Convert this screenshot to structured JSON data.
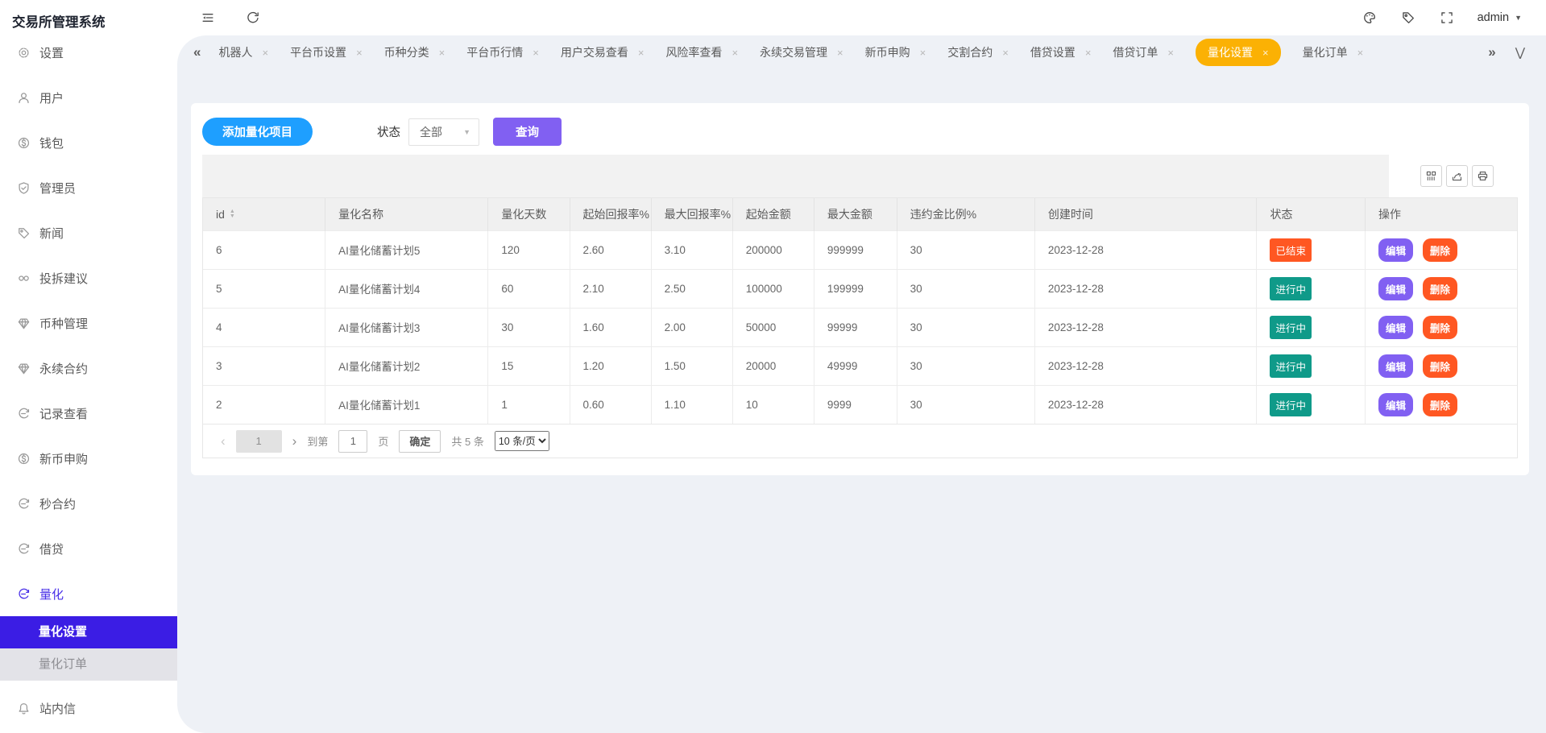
{
  "app": {
    "title": "交易所管理系统"
  },
  "sidebar": {
    "items": [
      {
        "label": "设置",
        "icon": "gear"
      },
      {
        "label": "用户",
        "icon": "user"
      },
      {
        "label": "钱包",
        "icon": "dollar"
      },
      {
        "label": "管理员",
        "icon": "shield"
      },
      {
        "label": "新闻",
        "icon": "tag"
      },
      {
        "label": "投拆建议",
        "icon": "infinity"
      },
      {
        "label": "币种管理",
        "icon": "gem"
      },
      {
        "label": "永续合约",
        "icon": "gem"
      },
      {
        "label": "记录查看",
        "icon": "circlearrow"
      },
      {
        "label": "新币申购",
        "icon": "dollar"
      },
      {
        "label": "秒合约",
        "icon": "circlearrow"
      },
      {
        "label": "借贷",
        "icon": "circlearrow"
      },
      {
        "label": "量化",
        "icon": "circlearrow",
        "active": true
      }
    ],
    "submenu": [
      {
        "label": "量化设置",
        "selected": true
      },
      {
        "label": "量化订单",
        "selected": false
      }
    ],
    "bottom_item": {
      "label": "站内信",
      "icon": "bell"
    }
  },
  "topbar": {
    "username": "admin"
  },
  "tabs": {
    "items": [
      {
        "label": "机器人"
      },
      {
        "label": "平台币设置"
      },
      {
        "label": "币种分类"
      },
      {
        "label": "平台币行情"
      },
      {
        "label": "用户交易查看"
      },
      {
        "label": "风险率查看"
      },
      {
        "label": "永续交易管理"
      },
      {
        "label": "新币申购"
      },
      {
        "label": "交割合约"
      },
      {
        "label": "借贷设置"
      },
      {
        "label": "借贷订单"
      },
      {
        "label": "量化设置",
        "active": true
      },
      {
        "label": "量化订单"
      }
    ]
  },
  "toolbar": {
    "add_button": "添加量化项目",
    "status_label": "状态",
    "status_value": "全部",
    "query_button": "查询"
  },
  "table": {
    "columns": [
      "id",
      "量化名称",
      "量化天数",
      "起始回报率%",
      "最大回报率%",
      "起始金额",
      "最大金额",
      "违约金比例%",
      "创建时间",
      "状态",
      "操作"
    ],
    "rows": [
      {
        "id": "6",
        "name": "AI量化储蓄计划5",
        "days": "120",
        "start_rate": "2.60",
        "max_rate": "3.10",
        "start_amount": "200000",
        "max_amount": "999999",
        "penalty": "30",
        "created": "2023-12-28",
        "status": "已结束",
        "status_type": "ended"
      },
      {
        "id": "5",
        "name": "AI量化储蓄计划4",
        "days": "60",
        "start_rate": "2.10",
        "max_rate": "2.50",
        "start_amount": "100000",
        "max_amount": "199999",
        "penalty": "30",
        "created": "2023-12-28",
        "status": "进行中",
        "status_type": "running"
      },
      {
        "id": "4",
        "name": "AI量化储蓄计划3",
        "days": "30",
        "start_rate": "1.60",
        "max_rate": "2.00",
        "start_amount": "50000",
        "max_amount": "99999",
        "penalty": "30",
        "created": "2023-12-28",
        "status": "进行中",
        "status_type": "running"
      },
      {
        "id": "3",
        "name": "AI量化储蓄计划2",
        "days": "15",
        "start_rate": "1.20",
        "max_rate": "1.50",
        "start_amount": "20000",
        "max_amount": "49999",
        "penalty": "30",
        "created": "2023-12-28",
        "status": "进行中",
        "status_type": "running"
      },
      {
        "id": "2",
        "name": "AI量化储蓄计划1",
        "days": "1",
        "start_rate": "0.60",
        "max_rate": "1.10",
        "start_amount": "10",
        "max_amount": "9999",
        "penalty": "30",
        "created": "2023-12-28",
        "status": "进行中",
        "status_type": "running"
      }
    ],
    "actions": {
      "edit": "编辑",
      "delete": "删除"
    }
  },
  "pagination": {
    "current_page": "1",
    "goto_label": "到第",
    "goto_value": "1",
    "page_unit": "页",
    "confirm_label": "确定",
    "total_label": "共 5 条",
    "page_size_label": "10 条/页"
  },
  "icons": {
    "note": "glyph icons used: collapse-icon, refresh-icon, palette-icon, tag-icon, fullscreen-icon, caret-down-icon, chevrons-left-icon, chevrons-right-icon, chevron-down-icon, close-icon, sort-icon, columns-icon, export-icon, print-icon, bell-icon"
  },
  "colors": {
    "active_tab": "#fbb104",
    "add_button": "#1e9fff",
    "purple_button": "#8160f2",
    "danger": "#ff5722",
    "running_badge": "#0f9a89",
    "sidebar_selected": "#3b1de4",
    "page_background": "#eef1f6"
  }
}
